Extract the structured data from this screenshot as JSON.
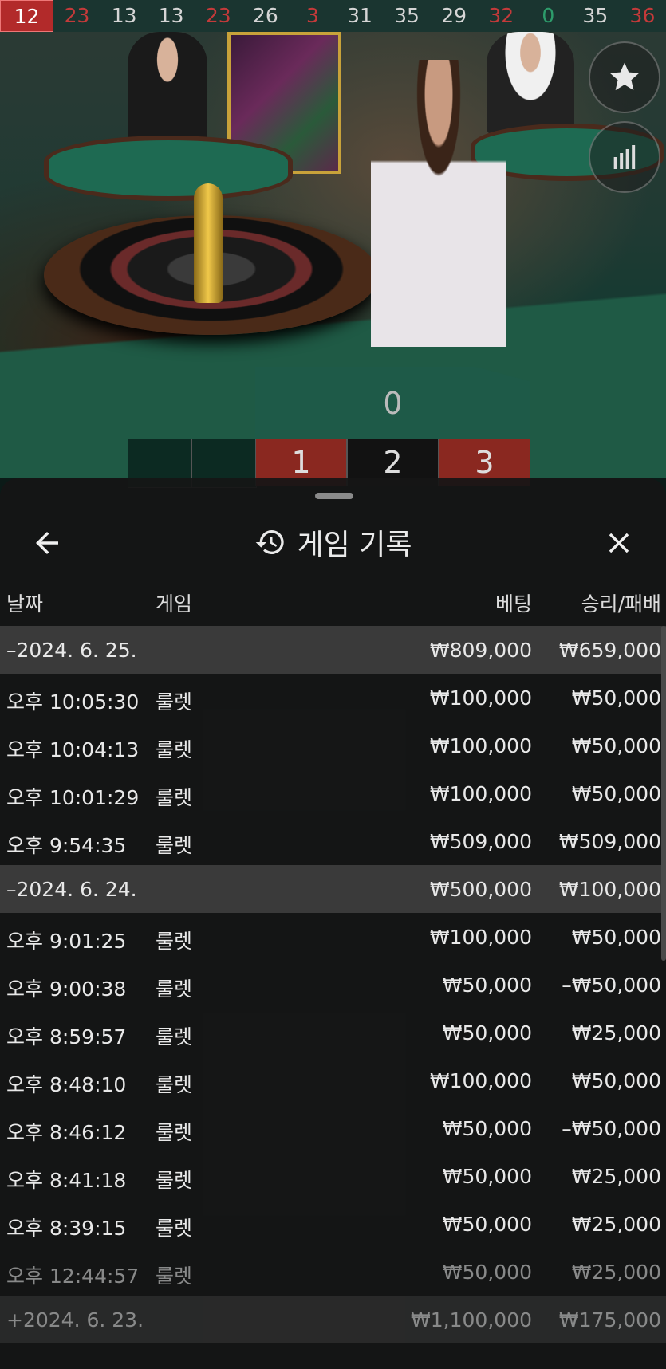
{
  "results_bar": [
    {
      "n": "12",
      "color": "red",
      "latest": true
    },
    {
      "n": "23",
      "color": "red"
    },
    {
      "n": "13",
      "color": "black"
    },
    {
      "n": "13",
      "color": "black"
    },
    {
      "n": "23",
      "color": "red"
    },
    {
      "n": "26",
      "color": "black"
    },
    {
      "n": "3",
      "color": "red"
    },
    {
      "n": "31",
      "color": "black"
    },
    {
      "n": "35",
      "color": "black"
    },
    {
      "n": "29",
      "color": "black"
    },
    {
      "n": "32",
      "color": "red"
    },
    {
      "n": "0",
      "color": "green"
    },
    {
      "n": "35",
      "color": "black"
    },
    {
      "n": "36",
      "color": "red"
    }
  ],
  "video_controls": {
    "favorite_icon": "star-icon",
    "stats_icon": "bar-chart-icon"
  },
  "board": {
    "zero": "0",
    "cells": [
      "1",
      "2",
      "3"
    ],
    "cell_colors": [
      "red",
      "black",
      "red"
    ]
  },
  "panel": {
    "title": "게임 기록",
    "back_icon": "arrow-left-icon",
    "history_icon": "history-icon",
    "close_icon": "close-icon",
    "columns": {
      "date": "날짜",
      "game": "게임",
      "bet": "베팅",
      "win_loss": "승리/패배"
    },
    "groups": [
      {
        "date": "–2024. 6. 25.",
        "bet": "₩809,000",
        "win_loss": "₩659,000",
        "rows": [
          {
            "time": "오후 10:05:30",
            "game": "룰렛",
            "bet": "₩100,000",
            "win_loss": "₩50,000"
          },
          {
            "time": "오후 10:04:13",
            "game": "룰렛",
            "bet": "₩100,000",
            "win_loss": "₩50,000"
          },
          {
            "time": "오후 10:01:29",
            "game": "룰렛",
            "bet": "₩100,000",
            "win_loss": "₩50,000"
          },
          {
            "time": "오후 9:54:35",
            "game": "룰렛",
            "bet": "₩509,000",
            "win_loss": "₩509,000"
          }
        ]
      },
      {
        "date": "–2024. 6. 24.",
        "bet": "₩500,000",
        "win_loss": "₩100,000",
        "rows": [
          {
            "time": "오후 9:01:25",
            "game": "룰렛",
            "bet": "₩100,000",
            "win_loss": "₩50,000"
          },
          {
            "time": "오후 9:00:38",
            "game": "룰렛",
            "bet": "₩50,000",
            "win_loss": "–₩50,000"
          },
          {
            "time": "오후 8:59:57",
            "game": "룰렛",
            "bet": "₩50,000",
            "win_loss": "₩25,000"
          },
          {
            "time": "오후 8:48:10",
            "game": "룰렛",
            "bet": "₩100,000",
            "win_loss": "₩50,000"
          },
          {
            "time": "오후 8:46:12",
            "game": "룰렛",
            "bet": "₩50,000",
            "win_loss": "–₩50,000"
          },
          {
            "time": "오후 8:41:18",
            "game": "룰렛",
            "bet": "₩50,000",
            "win_loss": "₩25,000"
          },
          {
            "time": "오후 8:39:15",
            "game": "룰렛",
            "bet": "₩50,000",
            "win_loss": "₩25,000"
          },
          {
            "time": "오후 12:44:57",
            "game": "룰렛",
            "bet": "₩50,000",
            "win_loss": "₩25,000"
          }
        ]
      },
      {
        "date": "+2024. 6. 23.",
        "bet": "₩1,100,000",
        "win_loss": "₩175,000",
        "rows": []
      }
    ]
  }
}
